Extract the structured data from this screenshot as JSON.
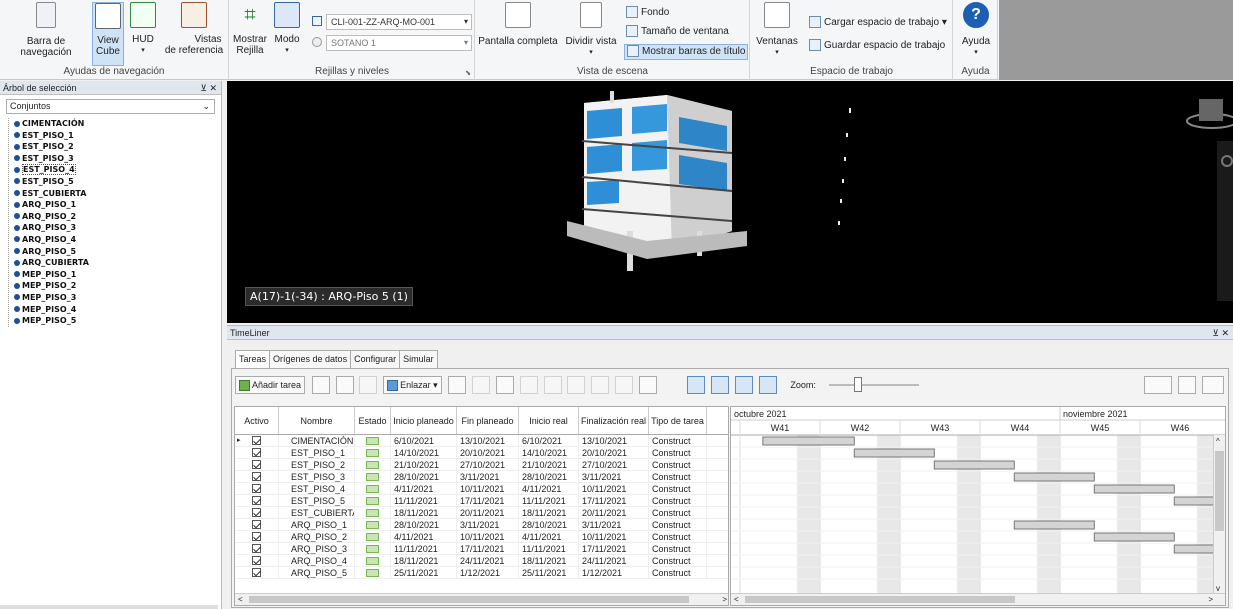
{
  "ribbon": {
    "nav_group": {
      "label": "Ayudas de navegación",
      "btn_navbar": "Barra de navegación",
      "btn_viewcube_l1": "View",
      "btn_viewcube_l2": "Cube",
      "btn_hud": "HUD",
      "btn_refviews_l1": "Vistas",
      "btn_refviews_l2": "de referencia"
    },
    "grid_group": {
      "label": "Rejillas y niveles",
      "btn_show_grid_l1": "Mostrar",
      "btn_show_grid_l2": "Rejilla",
      "btn_mode": "Modo",
      "model_combo": "CLI-001-ZZ-ARQ-MO-001",
      "level_combo": "SOTANO 1"
    },
    "scene_group": {
      "label": "Vista de escena",
      "btn_fullscreen": "Pantalla completa",
      "btn_split": "Dividir vista",
      "btn_background": "Fondo",
      "btn_window_size": "Tamaño de ventana",
      "btn_title_bars": "Mostrar barras de título"
    },
    "workspace_group": {
      "label": "Espacio de trabajo",
      "btn_windows": "Ventanas",
      "btn_load": "Cargar espacio de trabajo",
      "btn_save": "Guardar espacio de trabajo"
    },
    "help_group": {
      "label": "Ayuda",
      "btn_help": "Ayuda"
    }
  },
  "selection_tree": {
    "title": "Árbol de selección",
    "combo": "Conjuntos",
    "items": [
      "CIMENTACIÓN",
      "EST_PISO_1",
      "EST_PISO_2",
      "EST_PISO_3",
      "EST_PISO_4",
      "EST_PISO_5",
      "EST_CUBIERTA",
      "ARQ_PISO_1",
      "ARQ_PISO_2",
      "ARQ_PISO_3",
      "ARQ_PISO_4",
      "ARQ_PISO_5",
      "ARQ_CUBIERTA",
      "MEP_PISO_1",
      "MEP_PISO_2",
      "MEP_PISO_3",
      "MEP_PISO_4",
      "MEP_PISO_5"
    ]
  },
  "viewport": {
    "tooltip": "A(17)-1(-34) : ARQ-Piso 5 (1)"
  },
  "timeliner": {
    "title": "TimeLiner",
    "tabs": [
      "Tareas",
      "Orígenes de datos",
      "Configurar",
      "Simular"
    ],
    "btn_add_task": "Añadir tarea",
    "btn_link": "Enlazar",
    "zoom_label": "Zoom:",
    "columns": [
      "Activo",
      "Nombre",
      "Estado",
      "Inicio planeado",
      "Fin planeado",
      "Inicio real",
      "Finalización real",
      "Tipo de tarea"
    ],
    "rows": [
      [
        "CIMENTACIÓN",
        "6/10/2021",
        "13/10/2021",
        "6/10/2021",
        "13/10/2021",
        "Construct"
      ],
      [
        "EST_PISO_1",
        "14/10/2021",
        "20/10/2021",
        "14/10/2021",
        "20/10/2021",
        "Construct"
      ],
      [
        "EST_PISO_2",
        "21/10/2021",
        "27/10/2021",
        "21/10/2021",
        "27/10/2021",
        "Construct"
      ],
      [
        "EST_PISO_3",
        "28/10/2021",
        "3/11/2021",
        "28/10/2021",
        "3/11/2021",
        "Construct"
      ],
      [
        "EST_PISO_4",
        "4/11/2021",
        "10/11/2021",
        "4/11/2021",
        "10/11/2021",
        "Construct"
      ],
      [
        "EST_PISO_5",
        "11/11/2021",
        "17/11/2021",
        "11/11/2021",
        "17/11/2021",
        "Construct"
      ],
      [
        "EST_CUBIERTA",
        "18/11/2021",
        "20/11/2021",
        "18/11/2021",
        "20/11/2021",
        "Construct"
      ],
      [
        "ARQ_PISO_1",
        "28/10/2021",
        "3/11/2021",
        "28/10/2021",
        "3/11/2021",
        "Construct"
      ],
      [
        "ARQ_PISO_2",
        "4/11/2021",
        "10/11/2021",
        "4/11/2021",
        "10/11/2021",
        "Construct"
      ],
      [
        "ARQ_PISO_3",
        "11/11/2021",
        "17/11/2021",
        "11/11/2021",
        "17/11/2021",
        "Construct"
      ],
      [
        "ARQ_PISO_4",
        "18/11/2021",
        "24/11/2021",
        "18/11/2021",
        "24/11/2021",
        "Construct"
      ],
      [
        "ARQ_PISO_5",
        "25/11/2021",
        "1/12/2021",
        "25/11/2021",
        "1/12/2021",
        "Construct"
      ]
    ],
    "gantt": {
      "months": [
        "octubre 2021",
        "noviembre 2021"
      ],
      "weeks": [
        "W41",
        "W42",
        "W43",
        "W44",
        "W45",
        "W46"
      ]
    }
  }
}
